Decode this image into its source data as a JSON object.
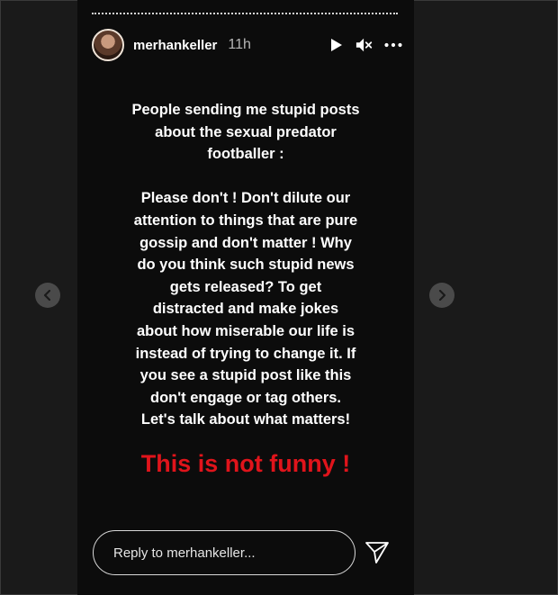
{
  "header": {
    "username": "merhankeller",
    "time": "11h"
  },
  "content": {
    "paragraph": "People sending me stupid posts\nabout the sexual predator\nfootballer :\n\nPlease don't ! Don't dilute our\nattention to things that are pure\ngossip and don't matter ! Why\ndo you think such stupid news\ngets released? To get\ndistracted and make jokes\nabout how miserable our life is\ninstead of trying to change it. If\nyou see a stupid post like this\ndon't engage or tag others.\nLet's talk about what matters!",
    "highlight": "This is not funny !"
  },
  "reply": {
    "placeholder": "Reply to merhankeller..."
  },
  "icons": {
    "play": "play-icon",
    "mute": "mute-icon",
    "more": "more-icon",
    "send": "send-icon",
    "prev": "chevron-left-icon",
    "next": "chevron-right-icon"
  },
  "colors": {
    "highlight": "#e0141b",
    "background": "#0c0c0c"
  }
}
